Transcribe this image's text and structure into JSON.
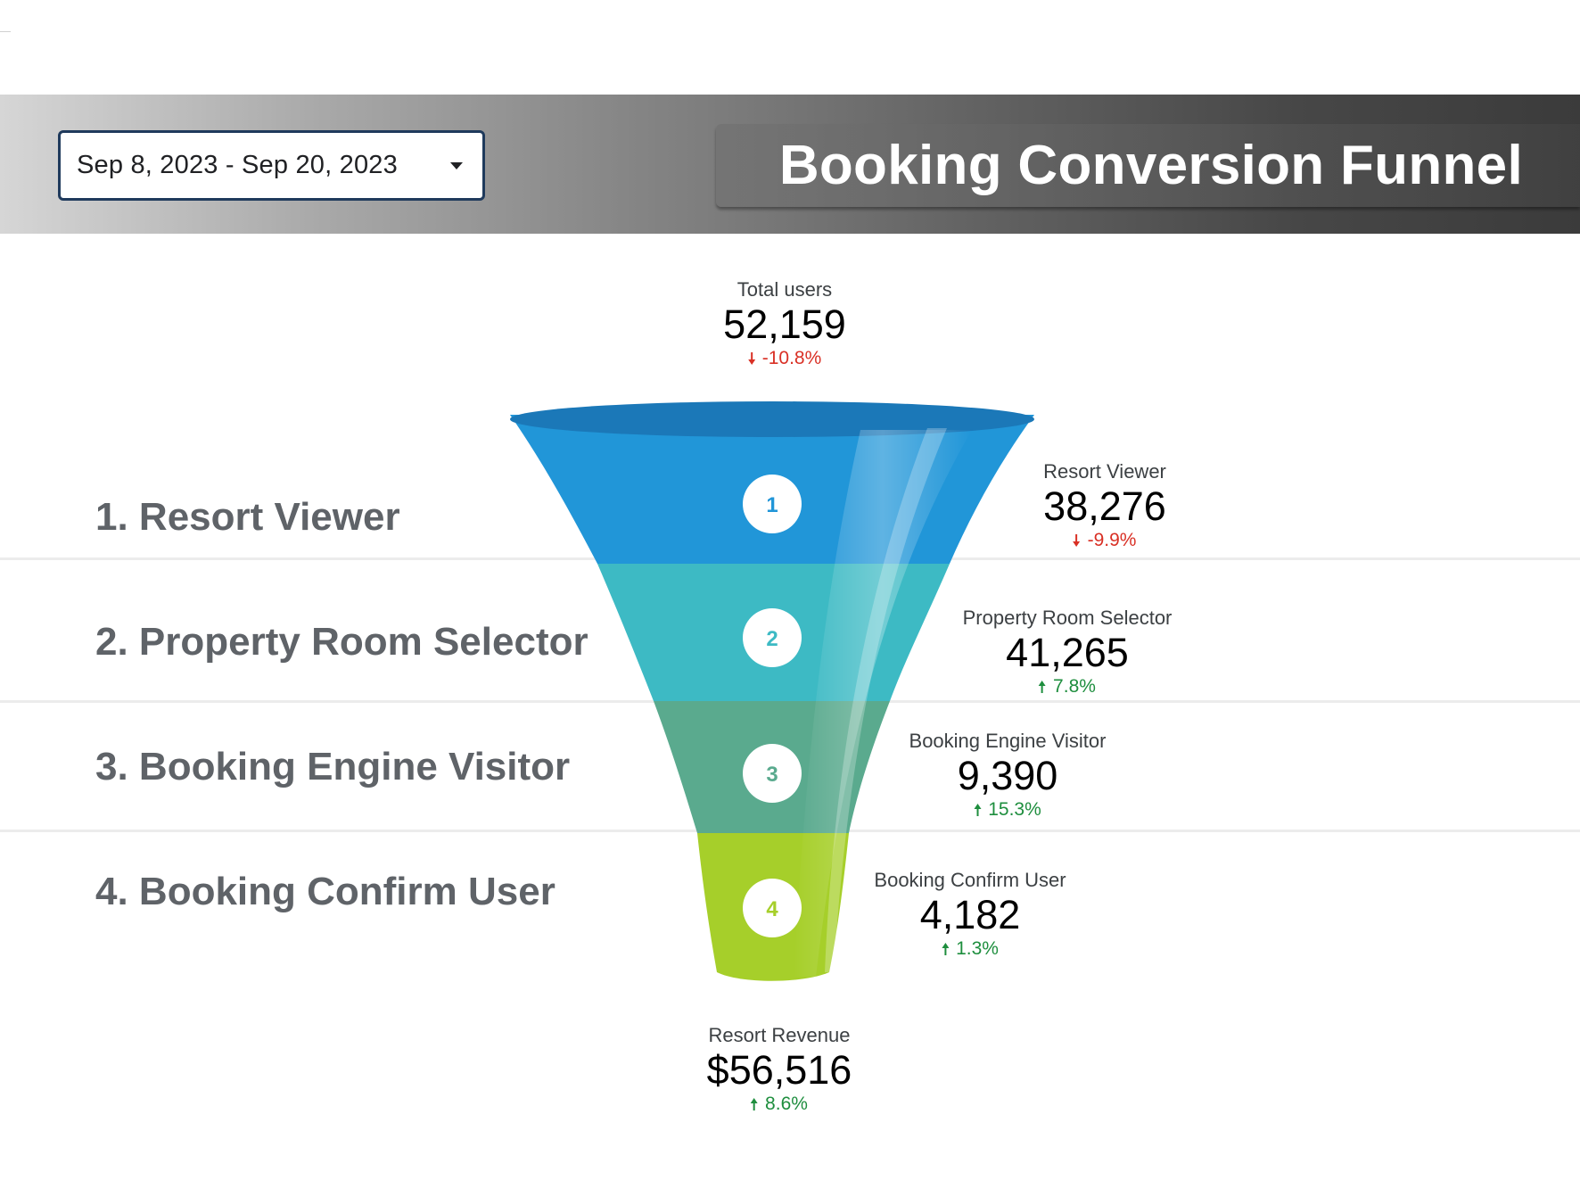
{
  "header": {
    "date_range": "Sep 8, 2023 - Sep 20, 2023",
    "title": "Booking Conversion Funnel"
  },
  "stages": [
    {
      "label": "1. Resort Viewer",
      "number": "1",
      "color": "#2196d8"
    },
    {
      "label": "2. Property Room Selector",
      "number": "2",
      "color": "#3dbac4"
    },
    {
      "label": "3. Booking Engine Visitor",
      "number": "3",
      "color": "#5aaa8e"
    },
    {
      "label": "4. Booking Confirm User",
      "number": "4",
      "color": "#a6cf2a"
    }
  ],
  "metrics": {
    "total_users": {
      "label": "Total users",
      "value": "52,159",
      "delta": "-10.8%",
      "direction": "down"
    },
    "resort_viewer": {
      "label": "Resort Viewer",
      "value": "38,276",
      "delta": "-9.9%",
      "direction": "down"
    },
    "property_room_selector": {
      "label": "Property Room Selector",
      "value": "41,265",
      "delta": "7.8%",
      "direction": "up"
    },
    "booking_engine_visitor": {
      "label": "Booking Engine Visitor",
      "value": "9,390",
      "delta": "15.3%",
      "direction": "up"
    },
    "booking_confirm_user": {
      "label": "Booking Confirm User",
      "value": "4,182",
      "delta": "1.3%",
      "direction": "up"
    },
    "resort_revenue": {
      "label": "Resort Revenue",
      "value": "$56,516",
      "delta": "8.6%",
      "direction": "up"
    }
  },
  "colors": {
    "delta_down": "#d93025",
    "delta_up": "#1e8e3e",
    "funnel_rim": "#1b78b8"
  }
}
